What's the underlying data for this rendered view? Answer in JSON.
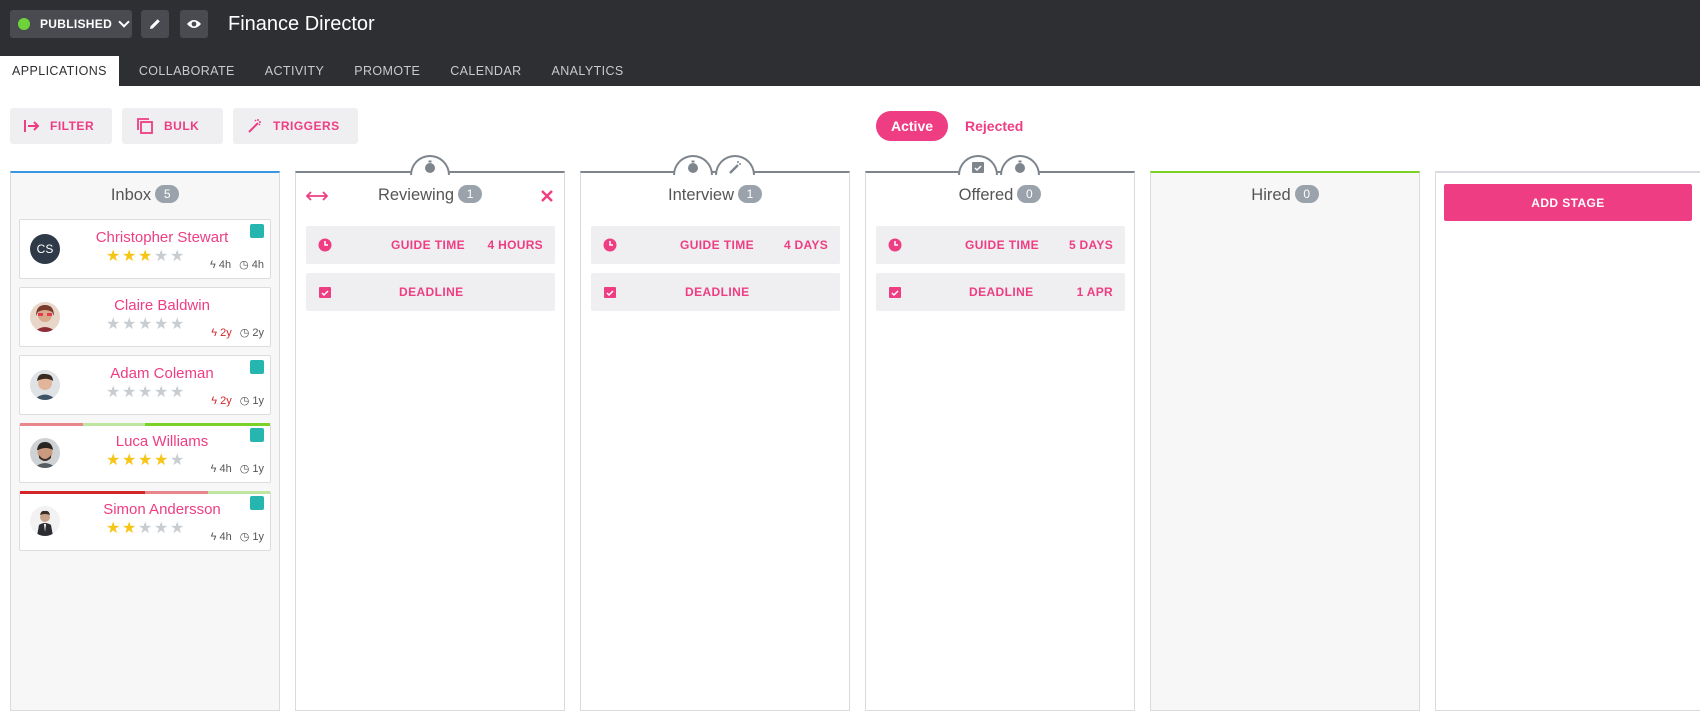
{
  "header": {
    "status_label": "PUBLISHED",
    "status_color": "#6cd33a",
    "job_title": "Finance Director",
    "edit_icon": "pencil-icon",
    "preview_icon": "eye-icon"
  },
  "tabs": [
    "APPLICATIONS",
    "COLLABORATE",
    "ACTIVITY",
    "PROMOTE",
    "CALENDAR",
    "ANALYTICS"
  ],
  "toolbar": {
    "filter_label": "FILTER",
    "bulk_label": "BULK",
    "triggers_label": "TRIGGERS",
    "active_label": "Active",
    "rejected_label": "Rejected"
  },
  "accent_color": "#ee3d82",
  "stages": {
    "inbox": {
      "name": "Inbox",
      "count": "5",
      "candidates": [
        {
          "name": "Christopher Stewart",
          "initials": "CS",
          "rating": 3,
          "last_activity": "4h",
          "age": "4h",
          "profile_badge": true
        },
        {
          "name": "Claire Baldwin",
          "rating": 0,
          "last_activity": "2y",
          "age": "2y",
          "profile_badge": false
        },
        {
          "name": "Adam Coleman",
          "rating": 0,
          "last_activity": "2y",
          "age": "1y",
          "profile_badge": true
        },
        {
          "name": "Luca Williams",
          "rating": 4,
          "last_activity": "4h",
          "age": "1y",
          "profile_badge": true
        },
        {
          "name": "Simon Andersson",
          "rating": 2,
          "last_activity": "4h",
          "age": "1y",
          "profile_badge": true
        }
      ]
    },
    "reviewing": {
      "name": "Reviewing",
      "count": "1",
      "guide_label": "GUIDE TIME",
      "guide_value": "4 HOURS",
      "deadline_label": "DEADLINE",
      "deadline_value": ""
    },
    "interview": {
      "name": "Interview",
      "count": "1",
      "guide_label": "GUIDE TIME",
      "guide_value": "4 DAYS",
      "deadline_label": "DEADLINE",
      "deadline_value": ""
    },
    "offered": {
      "name": "Offered",
      "count": "0",
      "guide_label": "GUIDE TIME",
      "guide_value": "5 DAYS",
      "deadline_label": "DEADLINE",
      "deadline_value": "1 APR"
    },
    "hired": {
      "name": "Hired",
      "count": "0"
    }
  },
  "add_stage_label": "ADD STAGE"
}
